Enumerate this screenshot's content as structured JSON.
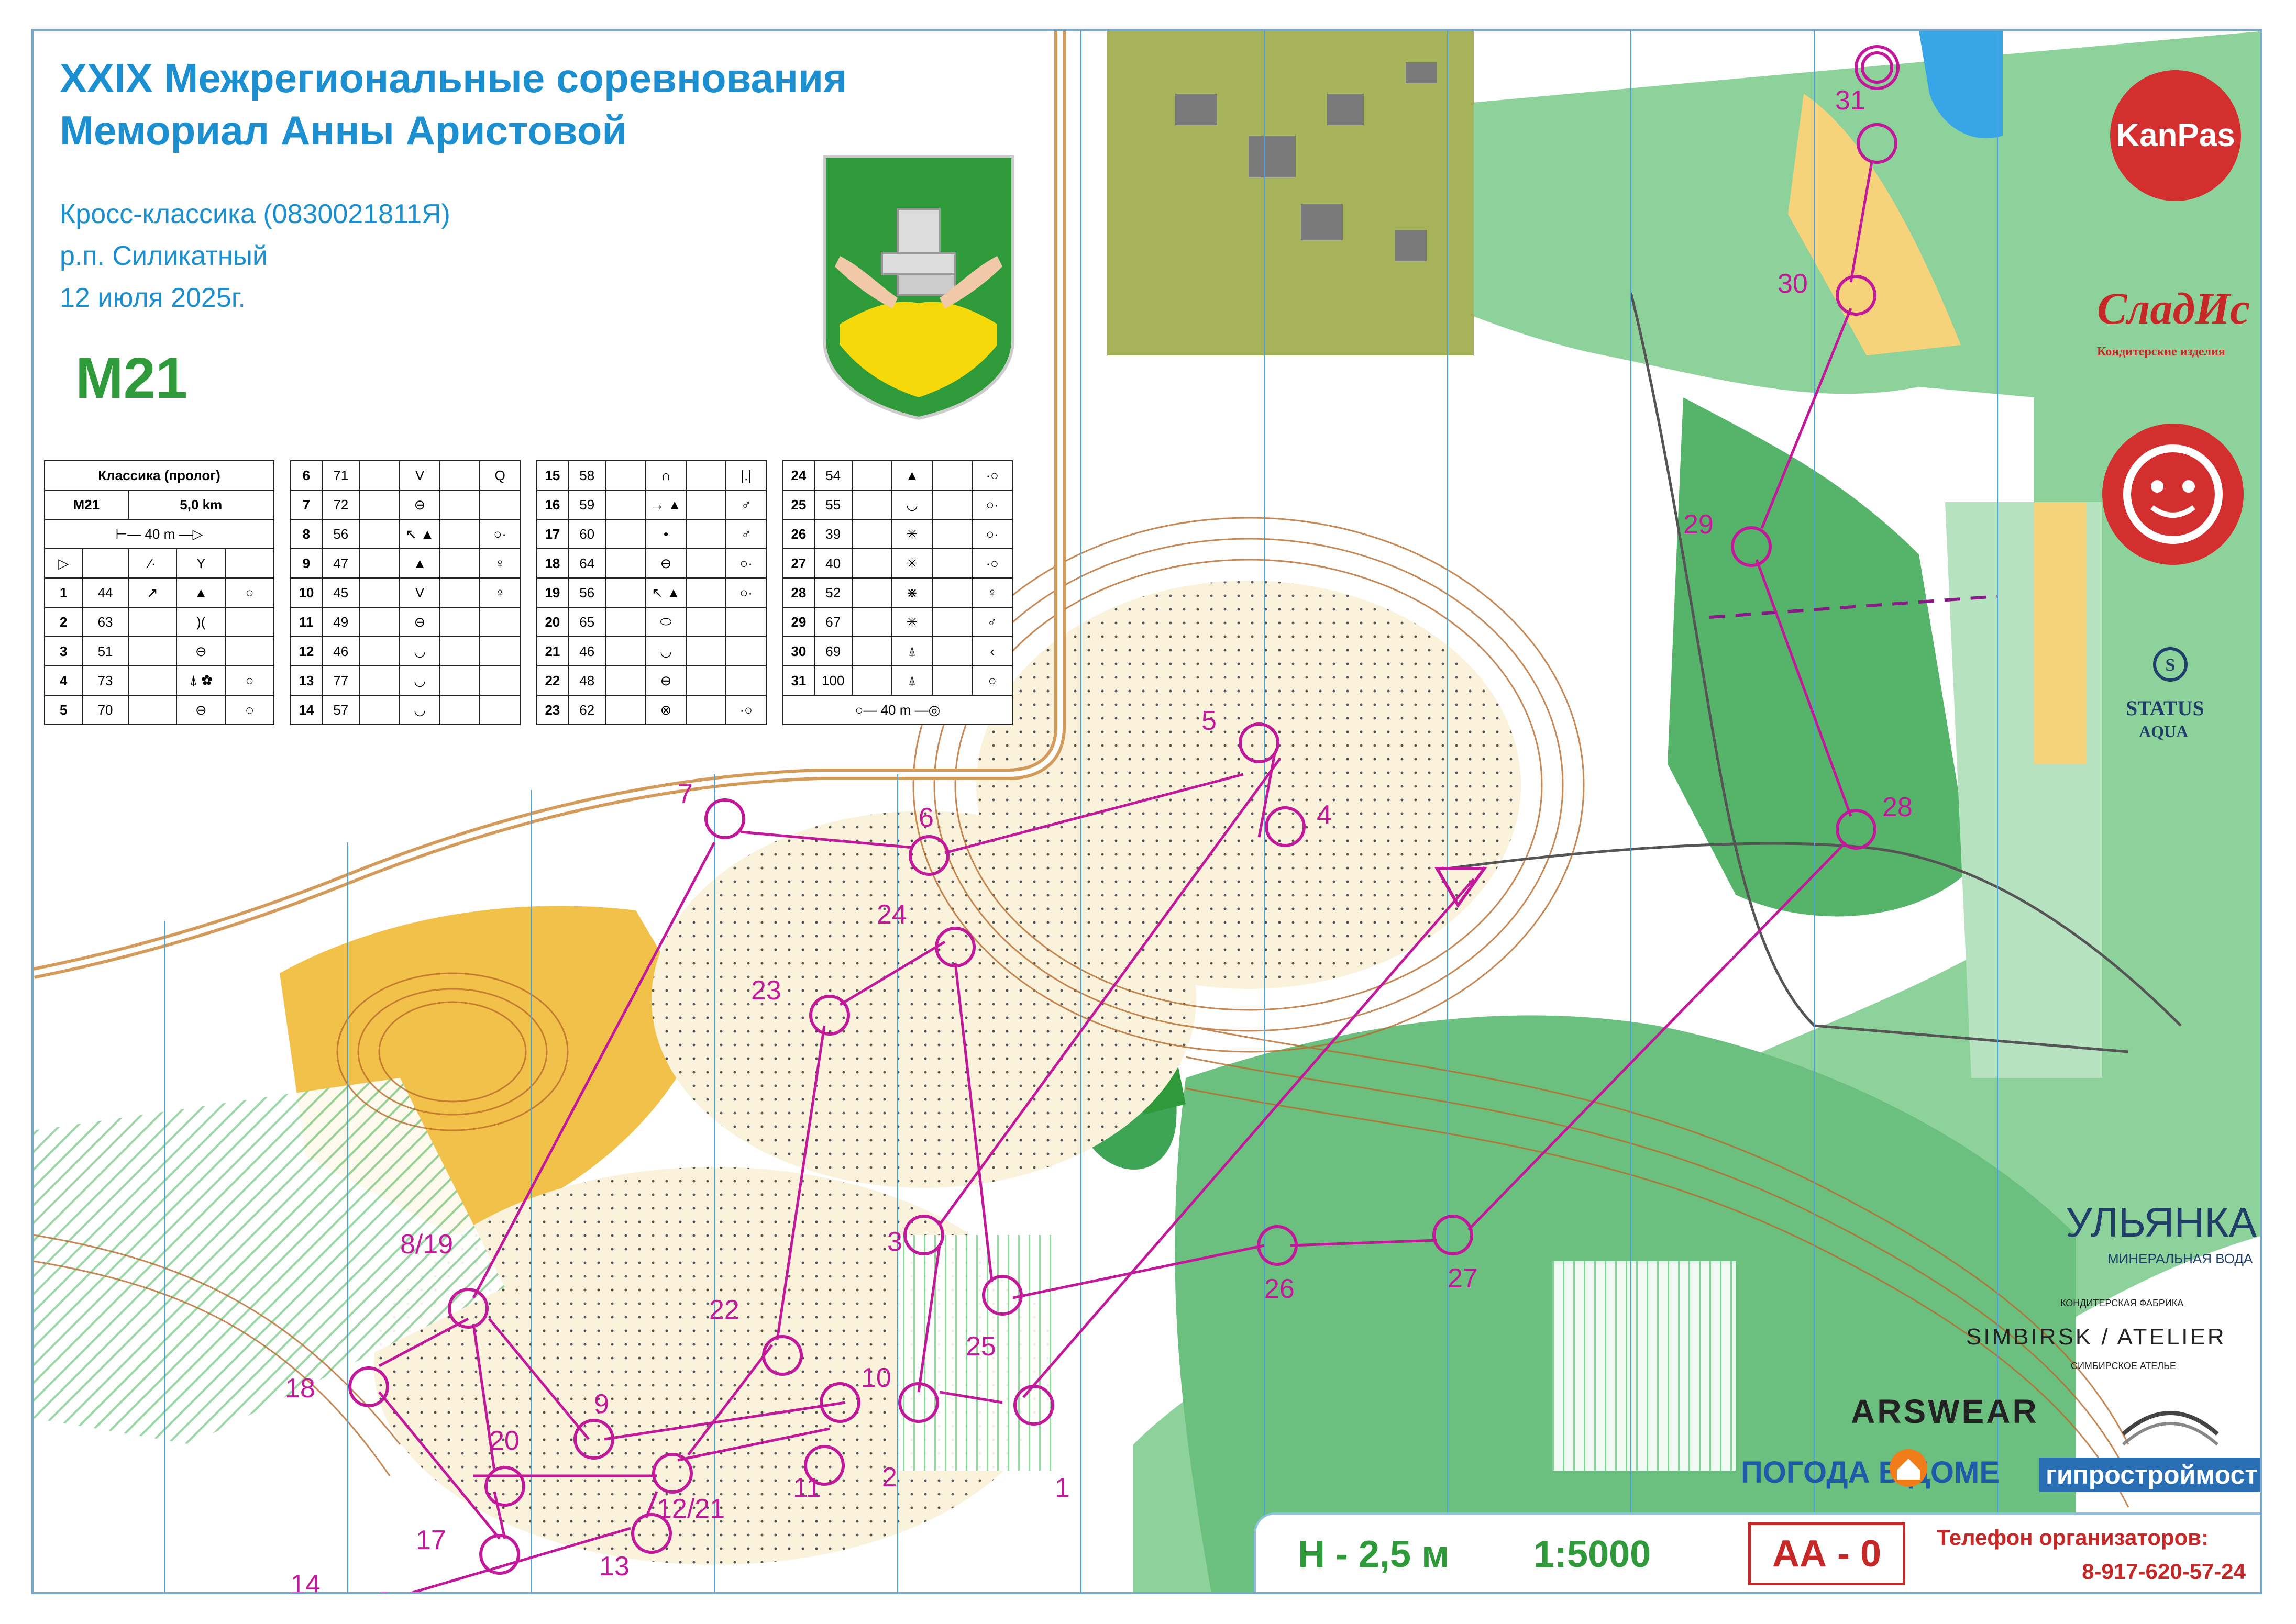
{
  "header": {
    "title_line1": "XXIX Межрегиональные соревнования",
    "title_line2": "Мемориал Анны Аристовой",
    "event_type": "Кросс-классика (0830021811Я)",
    "location": "р.п. Силикатный",
    "date": "12 июля 2025г.",
    "class_name": "М21"
  },
  "descriptions": {
    "header_title": "Классика (пролог)",
    "class": "М21",
    "length": "5,0 km",
    "start_distance": "40 m",
    "finish_distance": "40 m",
    "table1": [
      {
        "n": "1",
        "code": "44",
        "dir": "↗",
        "feat": "▲",
        "pos": "○"
      },
      {
        "n": "2",
        "code": "63",
        "dir": "",
        "feat": ")(",
        "pos": ""
      },
      {
        "n": "3",
        "code": "51",
        "dir": "",
        "feat": "⊖",
        "pos": ""
      },
      {
        "n": "4",
        "code": "73",
        "dir": "",
        "feat": "⍋ ✿",
        "pos": "○"
      },
      {
        "n": "5",
        "code": "70",
        "dir": "",
        "feat": "⊖",
        "pos": "◌"
      }
    ],
    "table2": [
      {
        "n": "6",
        "code": "71",
        "feat": "V",
        "pos": "Q"
      },
      {
        "n": "7",
        "code": "72",
        "feat": "⊖",
        "pos": ""
      },
      {
        "n": "8",
        "code": "56",
        "feat": "↖ ▲",
        "pos": "○·"
      },
      {
        "n": "9",
        "code": "47",
        "feat": "▲",
        "pos": "♀"
      },
      {
        "n": "10",
        "code": "45",
        "feat": "V",
        "pos": "♀"
      },
      {
        "n": "11",
        "code": "49",
        "feat": "⊖",
        "pos": ""
      },
      {
        "n": "12",
        "code": "46",
        "feat": "◡",
        "pos": ""
      },
      {
        "n": "13",
        "code": "77",
        "feat": "◡",
        "pos": ""
      },
      {
        "n": "14",
        "code": "57",
        "feat": "◡",
        "pos": ""
      }
    ],
    "table3": [
      {
        "n": "15",
        "code": "58",
        "feat": "∩",
        "pos": "|.|"
      },
      {
        "n": "16",
        "code": "59",
        "feat": "→ ▲",
        "pos": "♂"
      },
      {
        "n": "17",
        "code": "60",
        "feat": "•",
        "pos": "♂"
      },
      {
        "n": "18",
        "code": "64",
        "feat": "⊖",
        "pos": "○·"
      },
      {
        "n": "19",
        "code": "56",
        "feat": "↖ ▲",
        "pos": "○·"
      },
      {
        "n": "20",
        "code": "65",
        "feat": "⬭",
        "pos": ""
      },
      {
        "n": "21",
        "code": "46",
        "feat": "◡",
        "pos": ""
      },
      {
        "n": "22",
        "code": "48",
        "feat": "⊖",
        "pos": ""
      },
      {
        "n": "23",
        "code": "62",
        "feat": "⊗",
        "pos": "·○"
      }
    ],
    "table4": [
      {
        "n": "24",
        "code": "54",
        "feat": "▲",
        "pos": "·○"
      },
      {
        "n": "25",
        "code": "55",
        "feat": "◡",
        "pos": "○·"
      },
      {
        "n": "26",
        "code": "39",
        "feat": "✳",
        "pos": "○·"
      },
      {
        "n": "27",
        "code": "40",
        "feat": "✳",
        "pos": "·○"
      },
      {
        "n": "28",
        "code": "52",
        "feat": "⋇",
        "pos": "♀"
      },
      {
        "n": "29",
        "code": "67",
        "feat": "✳",
        "pos": "♂"
      },
      {
        "n": "30",
        "code": "69",
        "feat": "⍋",
        "pos": "‹"
      },
      {
        "n": "31",
        "code": "100",
        "feat": "⍋",
        "pos": "○"
      }
    ]
  },
  "controls": [
    {
      "label": "1"
    },
    {
      "label": "2"
    },
    {
      "label": "3"
    },
    {
      "label": "4"
    },
    {
      "label": "5"
    },
    {
      "label": "6"
    },
    {
      "label": "7"
    },
    {
      "label": "8/19"
    },
    {
      "label": "9"
    },
    {
      "label": "10"
    },
    {
      "label": "11"
    },
    {
      "label": "12/21"
    },
    {
      "label": "13"
    },
    {
      "label": "14"
    },
    {
      "label": "17"
    },
    {
      "label": "18"
    },
    {
      "label": "20"
    },
    {
      "label": "22"
    },
    {
      "label": "23"
    },
    {
      "label": "24"
    },
    {
      "label": "25"
    },
    {
      "label": "26"
    },
    {
      "label": "27"
    },
    {
      "label": "28"
    },
    {
      "label": "29"
    },
    {
      "label": "30"
    },
    {
      "label": "31"
    }
  ],
  "sponsors": {
    "kanpas": "KanPas",
    "sladis": "СладИс",
    "sladis_sub": "Кондитерские изделия",
    "status": "STATUS",
    "status_sub": "AQUA",
    "ulyanka": "УЛЬЯНКА",
    "ulyanka_sub": "МИНЕРАЛЬНАЯ ВОДА",
    "simbirsk": "SIMBIRSK / ATELIER",
    "simbirsk_top": "КОНДИТЕРСКАЯ ФАБРИКА",
    "simbirsk_sub": "СИМБИРСКОЕ АТЕЛЬЕ",
    "arswear": "ARSWEAR",
    "pogoda": "ПОГОДА В ДОМЕ",
    "giprostroy": "гипростроймост"
  },
  "footer": {
    "contour_interval": "H - 2,5 м",
    "scale": "1:5000",
    "aa": "АА - 0",
    "phone_label": "Телефон организаторов:",
    "phone": "8-917-620-57-24"
  },
  "colors": {
    "course": "#c2189a",
    "title_blue": "#1b8fd0",
    "class_green": "#2f9a3a",
    "forest_green": "#55b46a",
    "open_yellow": "#f2c14a",
    "contour_brown": "#b86b2c",
    "olive_buildings": "#8a9a3a",
    "water_blue": "#38a6e6",
    "red_accent": "#c62828"
  }
}
